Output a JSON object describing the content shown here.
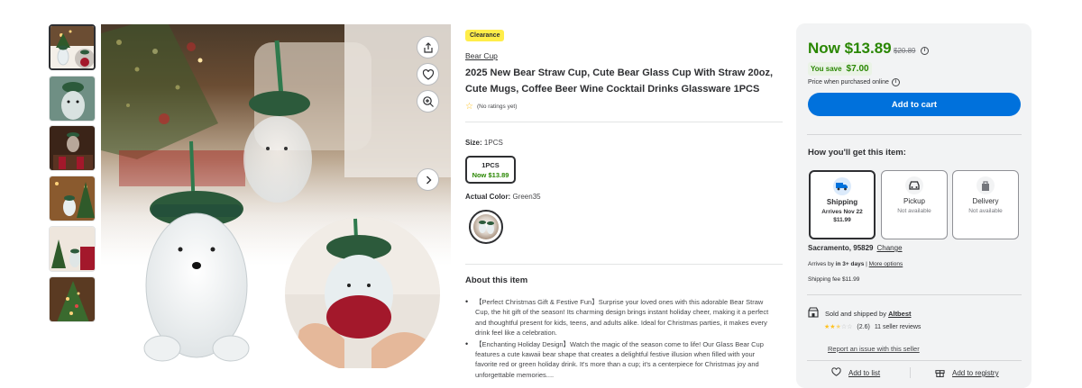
{
  "badge": "Clearance",
  "brand": "Bear Cup",
  "title": "2025 New Bear Straw Cup, Cute Bear Glass Cup With Straw 20oz, Cute Mugs, Coffee Beer Wine Cocktail Drinks Glassware 1PCS",
  "rating_text": "(No ratings yet)",
  "size": {
    "label": "Size:",
    "value": "1PCS",
    "option_name": "1PCS",
    "option_price": "Now $13.89"
  },
  "color": {
    "label": "Actual Color:",
    "value": "Green35"
  },
  "about": {
    "title": "About this item",
    "bullets": [
      "【Perfect Christmas Gift & Festive Fun】Surprise your loved ones with this adorable Bear Straw Cup, the hit gift of the season! Its charming design brings instant holiday cheer, making it a perfect and thoughtful present for kids, teens, and adults alike. Ideal for Christmas parties, it makes every drink feel like a celebration.",
      "【Enchanting Holiday Design】Watch the magic of the season come to life! Our Glass Bear Cup features a cute kawaii bear shape that creates a delightful festive illusion when filled with your favorite red or green holiday drink. It's more than a cup; it's a centerpiece for Christmas joy and unforgettable memories...."
    ]
  },
  "price": {
    "now": "Now $13.89",
    "was": "$20.89",
    "you_save_label": "You save",
    "you_save_amount": "$7.00",
    "when_purchased": "Price when purchased online",
    "add_to_cart": "Add to cart"
  },
  "fulfillment": {
    "title": "How you'll get this item:",
    "options": [
      {
        "name": "Shipping",
        "line1": "Arrives Nov 22",
        "line2": "$11.99",
        "icon": "truck-icon"
      },
      {
        "name": "Pickup",
        "line1": "Not available",
        "line2": "",
        "icon": "car-icon"
      },
      {
        "name": "Delivery",
        "line1": "Not available",
        "line2": "",
        "icon": "bag-icon"
      }
    ],
    "location": "Sacramento, 95829",
    "change": "Change",
    "arrives_prefix": "Arrives by",
    "arrives_bold": "in 3+ days",
    "more_options": "More options",
    "shipping_fee": "Shipping fee $11.99"
  },
  "seller": {
    "sold_by": "Sold and shipped by",
    "seller_name": "Altbest",
    "rating_value": "(2.6)",
    "reviews": "11 seller reviews",
    "report": "Report an issue with this seller"
  },
  "footer": {
    "add_to_list": "Add to list",
    "add_to_registry": "Add to registry"
  },
  "colors": {
    "walmart_blue": "#0071dc",
    "price_green": "#2a8703",
    "badge_yellow": "#ffed49"
  }
}
